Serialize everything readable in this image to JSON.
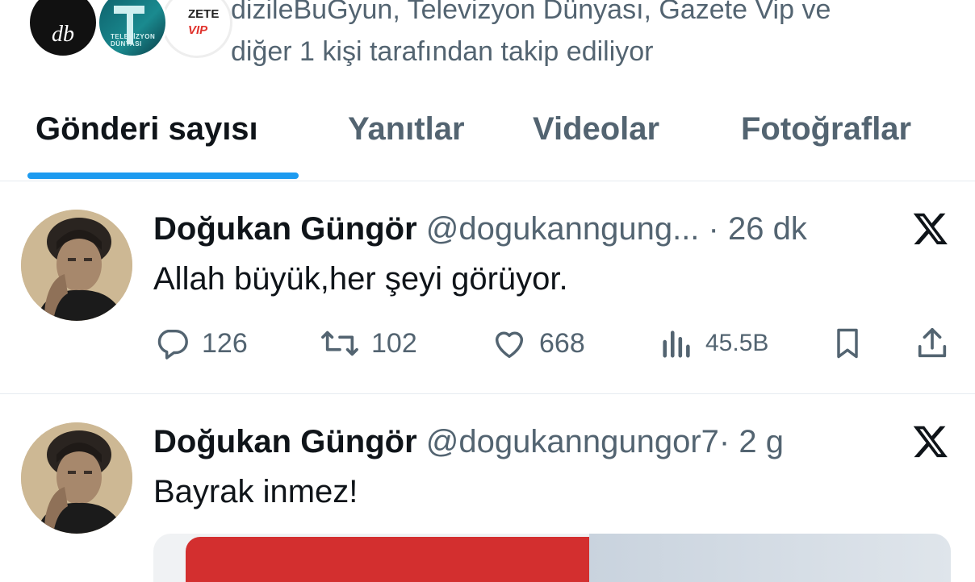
{
  "followers": {
    "avatars": [
      {
        "name": "db",
        "label": "db"
      },
      {
        "name": "televizyon-dunyasi",
        "label": "TELEVİZYON DÜNYASI"
      },
      {
        "name": "gazete-vip",
        "label_top": "ZETE",
        "label_bottom": "VIP"
      }
    ],
    "line1": "dizileBuGyun, Televizyon Dünyası, Gazete Vip ve",
    "line2": "diğer 1 kişi tarafından takip ediliyor"
  },
  "tabs": [
    {
      "label": "Gönderi sayısı",
      "active": true
    },
    {
      "label": "Yanıtlar",
      "active": false
    },
    {
      "label": "Videolar",
      "active": false
    },
    {
      "label": "Fotoğraflar",
      "active": false
    }
  ],
  "colors": {
    "accent": "#1d9bf0",
    "text": "#0f1419",
    "muted": "#536471",
    "divider": "#e6ecf0"
  },
  "tweets": [
    {
      "name": "Doğukan Güngör",
      "handle": "@dogukanngung...",
      "separator": "·",
      "time": "26 dk",
      "text": "Allah büyük,her şeyi görüyor.",
      "platform_icon": "x-logo-icon",
      "stats": {
        "replies": "126",
        "reposts": "102",
        "likes": "668",
        "views": "45.5B"
      }
    },
    {
      "name": "Doğukan Güngör",
      "handle": "@dogukanngungor7",
      "separator": "·",
      "time": "2 g",
      "text": "Bayrak inmez!",
      "platform_icon": "x-logo-icon",
      "has_media": true
    }
  ]
}
